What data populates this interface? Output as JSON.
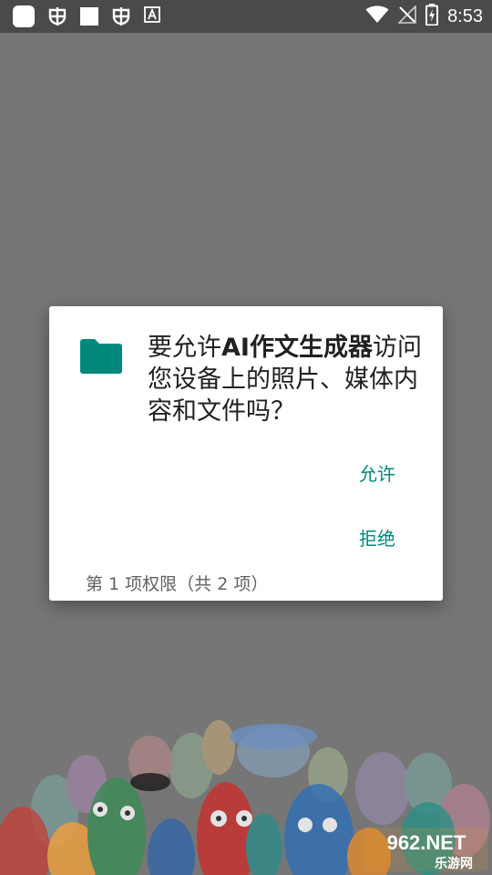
{
  "status_bar": {
    "time": "8:53",
    "left_icons": [
      "app-square-icon",
      "bug-icon",
      "stop-square-icon",
      "bug-icon",
      "font-a-icon"
    ],
    "right_icons": [
      "wifi-icon",
      "no-signal-icon",
      "battery-charging-icon"
    ]
  },
  "dialog": {
    "message_prefix": "要允许",
    "app_name": "AI作文生成器",
    "message_suffix": "访问您设备上的照片、媒体内容和文件吗？",
    "allow_label": "允许",
    "deny_label": "拒绝",
    "counter": "第 1 项权限（共 2 项）",
    "icon": "folder-icon",
    "accent_color": "#00897b"
  },
  "watermark": {
    "text_top": "962.NET",
    "text_bottom": "乐游网"
  }
}
